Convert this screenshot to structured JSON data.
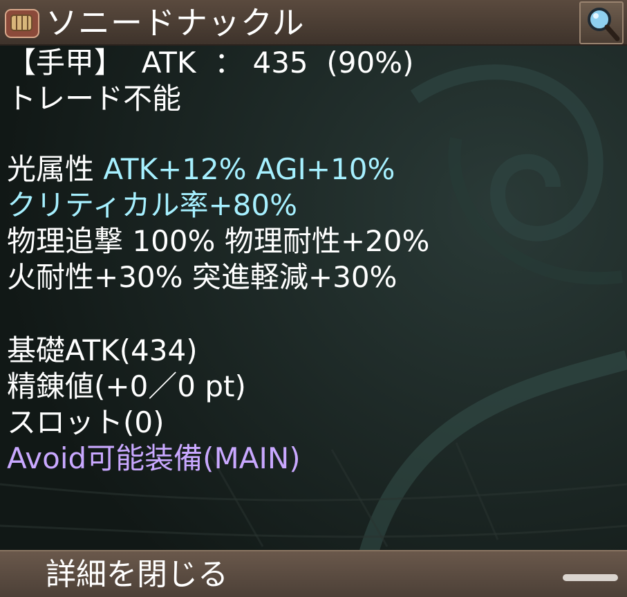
{
  "header": {
    "title": "ソニードナックル",
    "item_icon": "knuckle-gauntlet-icon",
    "search_icon": "magnifier-icon"
  },
  "details": {
    "line1": {
      "type": "【手甲】",
      "stat_label": "ATK",
      "separator": "：",
      "value": "435",
      "percent": "(90%)"
    },
    "line2": "トレード不能",
    "element": {
      "label": "光属性",
      "bonus1": "ATK+12%",
      "bonus2": "AGI+10%"
    },
    "crit": "クリティカル率+80%",
    "line5": {
      "a": "物理追撃",
      "a_value": "100%",
      "b": "物理耐性+20%"
    },
    "line6": {
      "a": "火耐性+30%",
      "b": "突進軽減+30%"
    },
    "base_atk": "基礎ATK(434)",
    "refine": "精錬値(+0／0 pt)",
    "slot": "スロット(0)",
    "avoid": "Avoid可能装備(MAIN)"
  },
  "footer": {
    "close_label": "詳細を閉じる"
  },
  "colors": {
    "text": "#ffffff",
    "cyan": "#a6f0ff",
    "violet": "#c9a8ff",
    "bar": "#5a4a3e"
  }
}
